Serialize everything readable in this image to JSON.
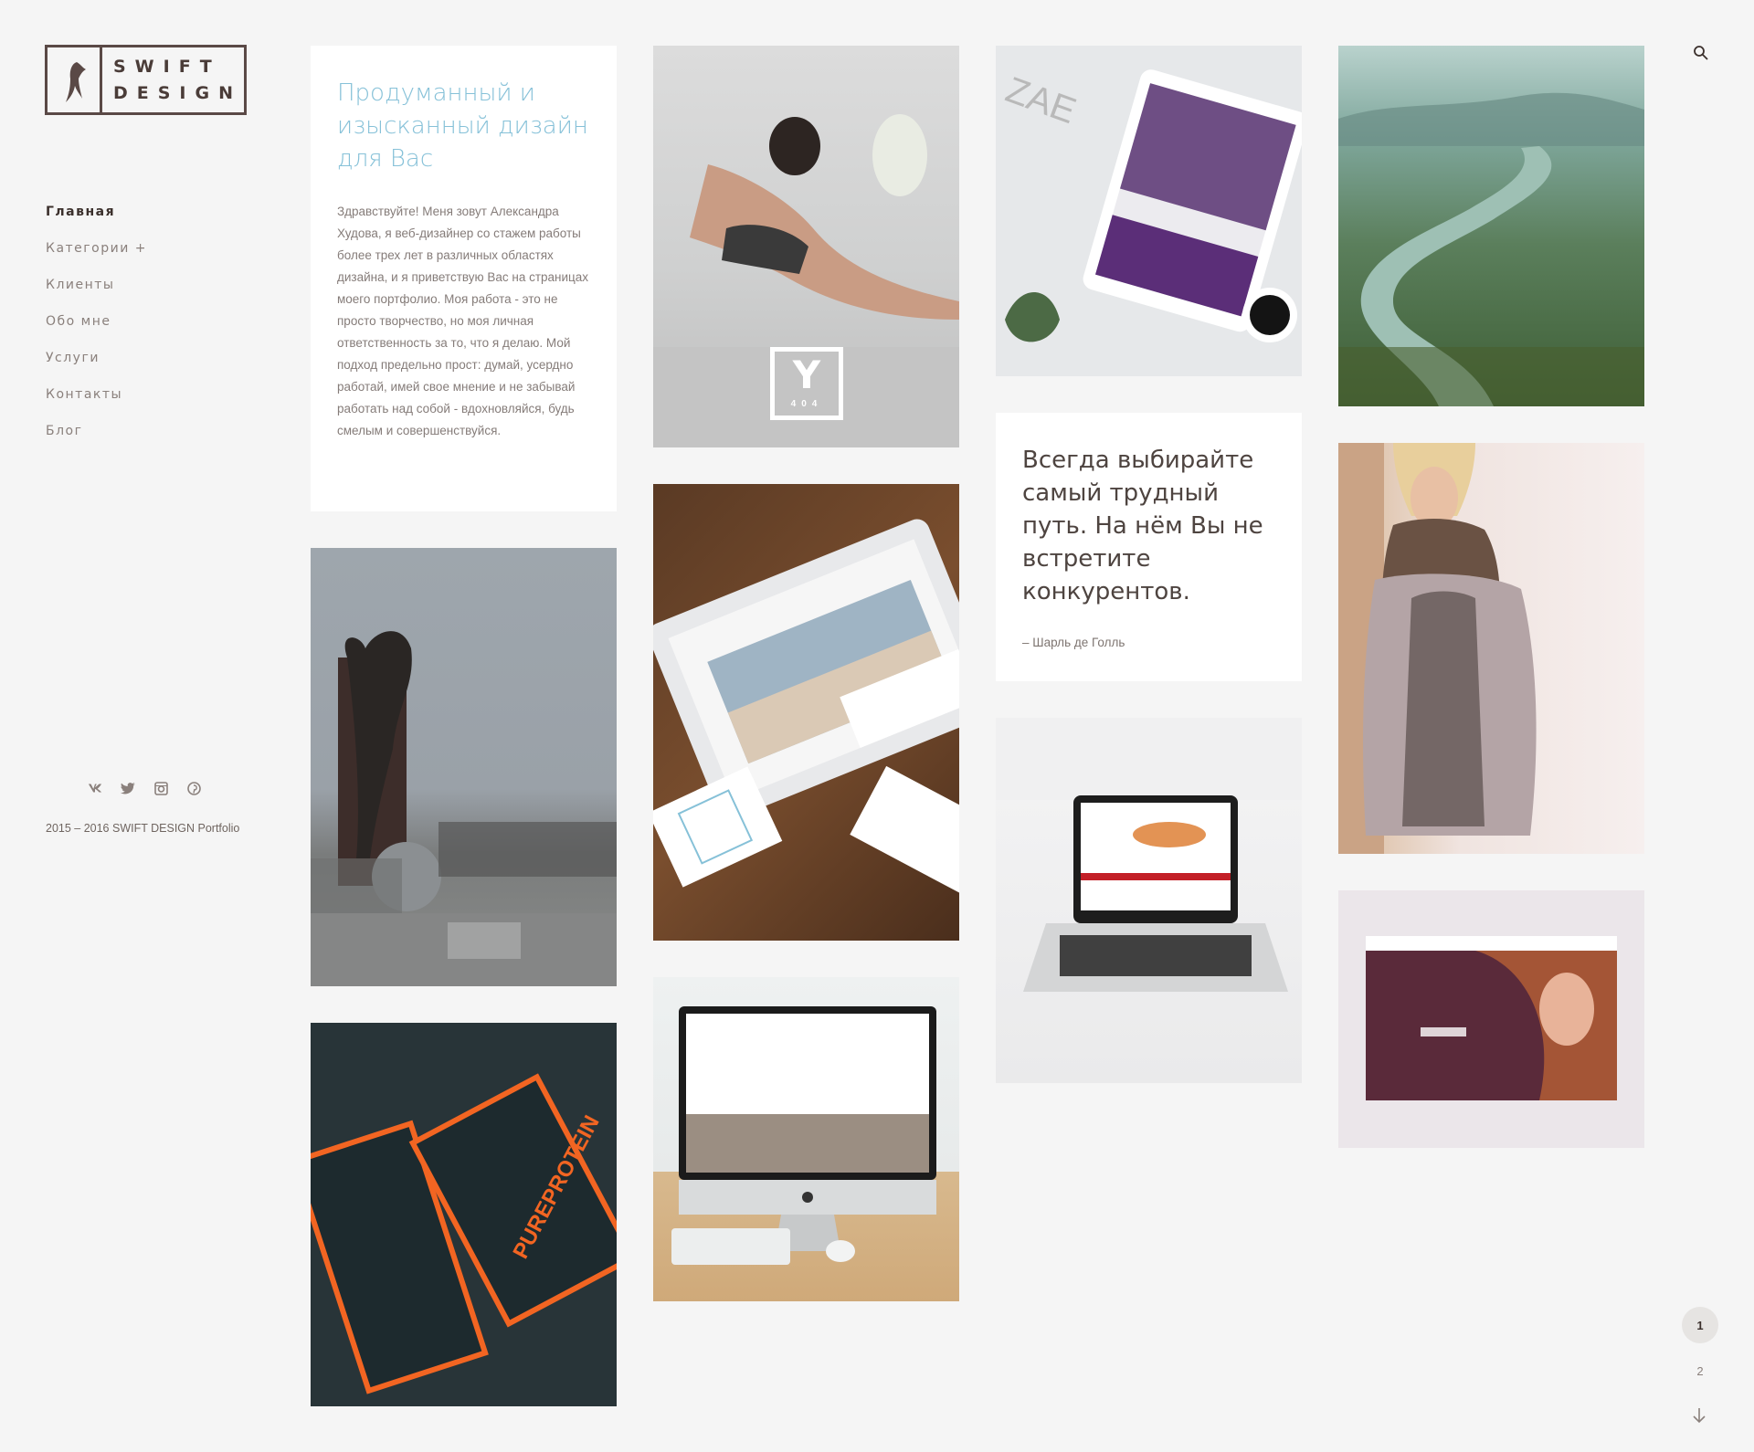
{
  "logo": {
    "line1": "SWIFT",
    "line2": "DESIGN",
    "icon": "swallow-bird-icon"
  },
  "nav": [
    {
      "label": "Главная",
      "active": true
    },
    {
      "label": "Категории +"
    },
    {
      "label": "Клиенты"
    },
    {
      "label": "Обо мне"
    },
    {
      "label": "Услуги"
    },
    {
      "label": "Контакты"
    },
    {
      "label": "Блог"
    }
  ],
  "socials": [
    "vk-icon",
    "twitter-icon",
    "instagram-icon",
    "pinterest-icon"
  ],
  "copyright": "2015 – 2016 SWIFT DESIGN Portfolio",
  "intro": {
    "title": "Продуманный и изысканный дизайн для Вас",
    "body": "Здравствуйте! Меня зовут Александра Худова, я веб-дизайнер со стажем работы более трех лет в различных областях дизайна, и я приветствую Вас на страницах моего портфолио. Моя работа - это не просто творчество, но моя личная ответственность за то, что я делаю. Мой подход предельно прост: думай, усердно работай, имей свое мнение и не забывай работать над собой - вдохновляйся, будь смелым и совершенствуйся."
  },
  "quote": {
    "text": "Всегда выбирайте самый трудный путь. На нём Вы не встретите конкурентов.",
    "author": "– Шарль де Голль"
  },
  "yoga_logo": {
    "letter": "Y",
    "number": "404"
  },
  "pagination": {
    "pages": [
      "1",
      "2"
    ],
    "current": "1"
  },
  "colors": {
    "accent": "#86c1d8",
    "background": "#f5f5f5",
    "text": "#5a4e49"
  }
}
